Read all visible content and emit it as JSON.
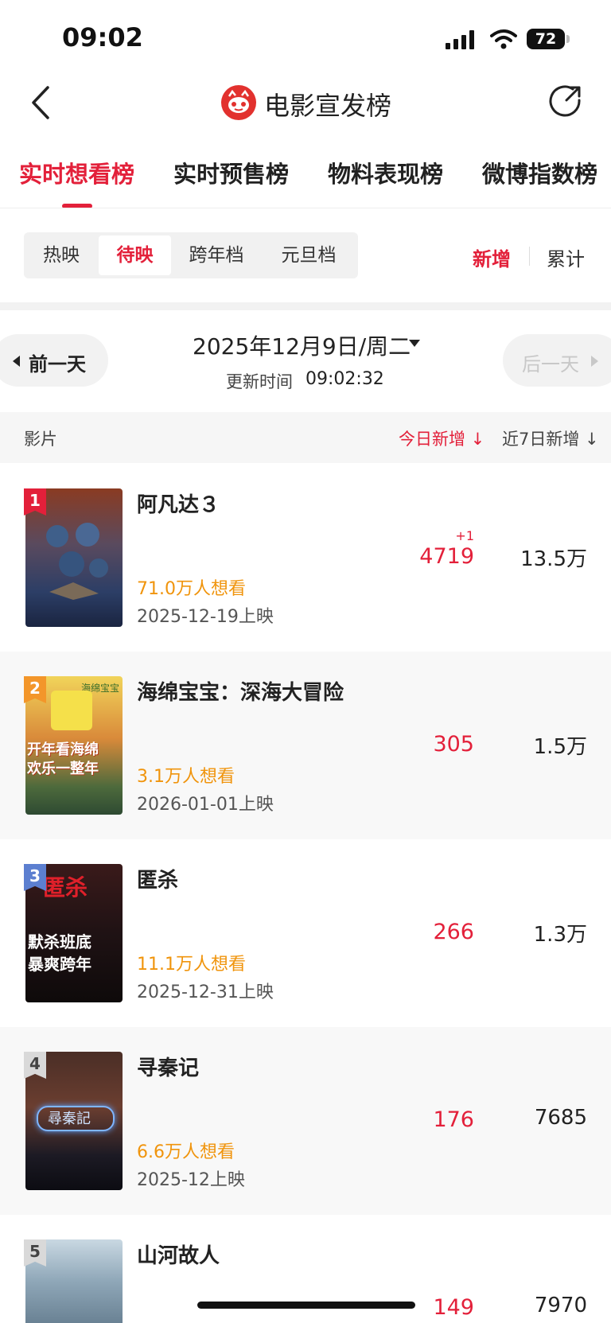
{
  "status": {
    "time": "09:02",
    "battery": "72"
  },
  "nav": {
    "title": "电影宣发榜"
  },
  "tabs": [
    "实时想看榜",
    "实时预售榜",
    "物料表现榜",
    "微博指数榜"
  ],
  "segments": [
    "热映",
    "待映",
    "跨年档",
    "元旦档"
  ],
  "modes": {
    "new": "新增",
    "total": "累计"
  },
  "date": {
    "prev": "前一天",
    "current": "2025年12月9日/周二",
    "next": "后一天",
    "update_label": "更新时间",
    "update_time": "09:02:32"
  },
  "header": {
    "film": "影片",
    "today": "今日新增",
    "week": "近7日新增"
  },
  "colors": {
    "accent": "#e3203a",
    "want": "#f0940c",
    "rank1": "#e3203a",
    "rank2": "#f3962a",
    "rank3": "#5c7fd0",
    "rank4": "#d9d9d9"
  },
  "movies": [
    {
      "rank": "1",
      "name": "阿凡达３",
      "want": "71.0万人想看",
      "release": "2025-12-19上映",
      "today": "4719",
      "delta": "+1",
      "week": "13.5万"
    },
    {
      "rank": "2",
      "name": "海绵宝宝：深海大冒险",
      "want": "3.1万人想看",
      "release": "2026-01-01上映",
      "today": "305",
      "delta": "",
      "week": "1.5万",
      "poster_text": [
        "海绵宝宝",
        "开年看海绵",
        "欢乐一整年"
      ]
    },
    {
      "rank": "3",
      "name": "匿杀",
      "want": "11.1万人想看",
      "release": "2025-12-31上映",
      "today": "266",
      "delta": "",
      "week": "1.3万",
      "poster_text": [
        "匿杀",
        "默杀班底",
        "暴爽跨年"
      ]
    },
    {
      "rank": "4",
      "name": "寻秦记",
      "want": "6.6万人想看",
      "release": "2025-12上映",
      "today": "176",
      "delta": "",
      "week": "7685",
      "poster_text": [
        "尋秦記"
      ]
    },
    {
      "rank": "5",
      "name": "山河故人",
      "want": "",
      "release": "",
      "today": "149",
      "delta": "",
      "week": "7970"
    }
  ]
}
